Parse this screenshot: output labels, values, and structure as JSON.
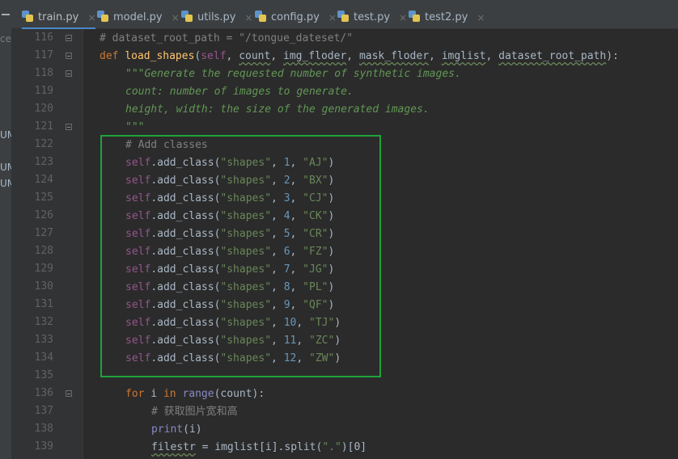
{
  "tabs": [
    {
      "label": "train.py",
      "active": true
    },
    {
      "label": "model.py",
      "active": false
    },
    {
      "label": "utils.py",
      "active": false
    },
    {
      "label": "config.py",
      "active": false
    },
    {
      "label": "test.py",
      "active": false
    },
    {
      "label": "test2.py",
      "active": false
    }
  ],
  "tab_close_glyph": "×",
  "side_fragments": [
    "ce\\",
    "UM",
    "UM",
    "UM"
  ],
  "line_numbers": [
    "116",
    "117",
    "118",
    "119",
    "120",
    "121",
    "122",
    "123",
    "124",
    "125",
    "126",
    "127",
    "128",
    "129",
    "130",
    "131",
    "132",
    "133",
    "134",
    "135",
    "136",
    "137",
    "138",
    "139"
  ],
  "code": {
    "l116": "# dataset_root_path = \"/tongue_dateset/\"",
    "l117": {
      "def": "def",
      "name": "load_shapes",
      "open": "(",
      "self": "self",
      "p1": "count",
      "p2": "img_floder",
      "p3": "mask_floder",
      "p4": "imglist",
      "p5": "dataset_root_path",
      "close": "):",
      "comma": ", "
    },
    "l118": "\"\"\"Generate the requested number of synthetic images.",
    "l119": "count: number of images to generate.",
    "l120": "height, width: the size of the generated images.",
    "l121": "\"\"\"",
    "l122": "# Add classes",
    "add_class": {
      "self": "self",
      "method": ".add_class(",
      "source": "\"shapes\"",
      "sep": ", ",
      "close": ")"
    },
    "classes": [
      {
        "id": "1",
        "name": "\"AJ\""
      },
      {
        "id": "2",
        "name": "\"BX\""
      },
      {
        "id": "3",
        "name": "\"CJ\""
      },
      {
        "id": "4",
        "name": "\"CK\""
      },
      {
        "id": "5",
        "name": "\"CR\""
      },
      {
        "id": "6",
        "name": "\"FZ\""
      },
      {
        "id": "7",
        "name": "\"JG\""
      },
      {
        "id": "8",
        "name": "\"PL\""
      },
      {
        "id": "9",
        "name": "\"QF\""
      },
      {
        "id": "10",
        "name": "\"TJ\""
      },
      {
        "id": "11",
        "name": "\"ZC\""
      },
      {
        "id": "12",
        "name": "\"ZW\""
      }
    ],
    "l136": {
      "for": "for",
      "i": " i ",
      "in": "in",
      "range": "range",
      "rest": "(count):"
    },
    "l137": "# 获取图片宽和高",
    "l138": {
      "print": "print",
      "rest": "(i)"
    },
    "l139": {
      "var": "filestr",
      "eq": " = imglist[i].split(",
      "str": "\".\"",
      "rest": ")[0]"
    }
  },
  "colors": {
    "background": "#2b2b2b",
    "keyword": "#cc7832",
    "function": "#ffc66d",
    "self": "#94558d",
    "string": "#6a8759",
    "number": "#6897bb",
    "comment": "#808080",
    "highlight_box": "#1fa33a",
    "active_tab_underline": "#4a88c7"
  },
  "icons": {
    "tab": "python-file-icon",
    "fold": "fold-marker-icon"
  }
}
